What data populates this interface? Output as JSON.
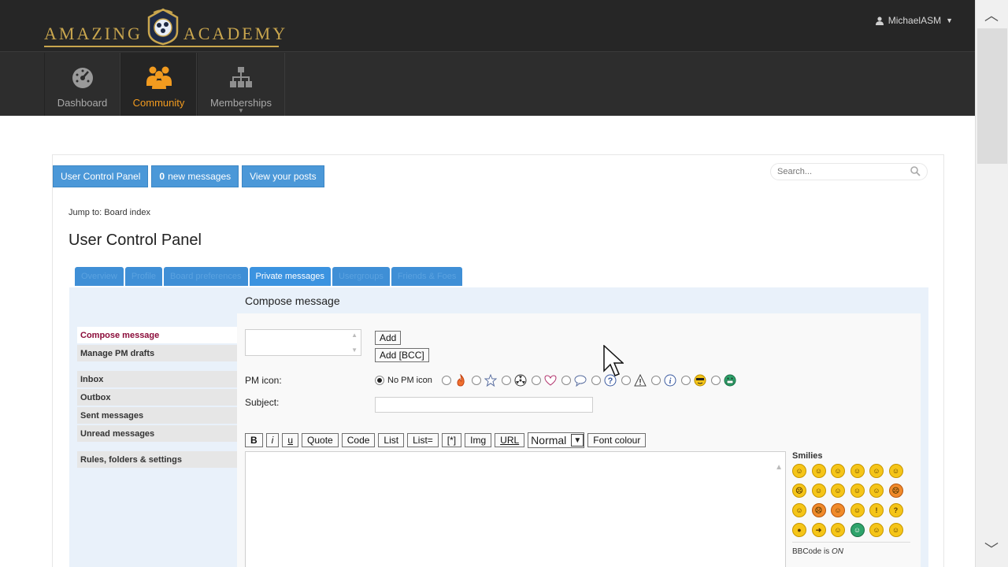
{
  "brand": {
    "left_word": "AMAZING",
    "right_word": "ACADEMY",
    "gold": "#c9a64e"
  },
  "user_menu": {
    "username": "MichaelASM"
  },
  "nav": [
    {
      "label": "Dashboard",
      "icon": "gauge-icon",
      "active": false
    },
    {
      "label": "Community",
      "icon": "people-icon",
      "active": true
    },
    {
      "label": "Memberships",
      "icon": "org-chart-icon",
      "active": false
    }
  ],
  "quick_links": {
    "ucp": "User Control Panel",
    "new_count": "0",
    "new_messages": "new messages",
    "view_posts": "View your posts"
  },
  "search": {
    "placeholder": "Search..."
  },
  "jump": {
    "prefix": "Jump to:",
    "target": "Board index"
  },
  "page_title": "User Control Panel",
  "tabs": [
    "Overview",
    "Profile",
    "Board preferences",
    "Private messages",
    "Usergroups",
    "Friends & Foes"
  ],
  "active_tab": "Private messages",
  "sidebar": [
    "Compose message",
    "Manage PM drafts",
    "Inbox",
    "Outbox",
    "Sent messages",
    "Unread messages",
    "Rules, folders & settings"
  ],
  "compose": {
    "title": "Compose message",
    "add": "Add",
    "add_bcc": "Add [BCC]",
    "pm_icon_label": "PM icon:",
    "no_pm_icon": "No PM icon",
    "subject_label": "Subject:"
  },
  "toolbar": {
    "bold": "B",
    "italic": "i",
    "underline": "u",
    "quote": "Quote",
    "code": "Code",
    "list": "List",
    "list_eq": "List=",
    "list_item": "[*]",
    "img": "Img",
    "url": "URL",
    "font_size": "Normal",
    "font_colour": "Font colour"
  },
  "smilies": {
    "heading": "Smilies",
    "bbcode_label": "BBCode is",
    "bbcode_state": "ON"
  },
  "colors": {
    "accent": "#f29b1f",
    "tab_blue": "#3b93e0",
    "quick_blue": "#4b98d8",
    "active_sidebar": "#8b0c3a"
  }
}
